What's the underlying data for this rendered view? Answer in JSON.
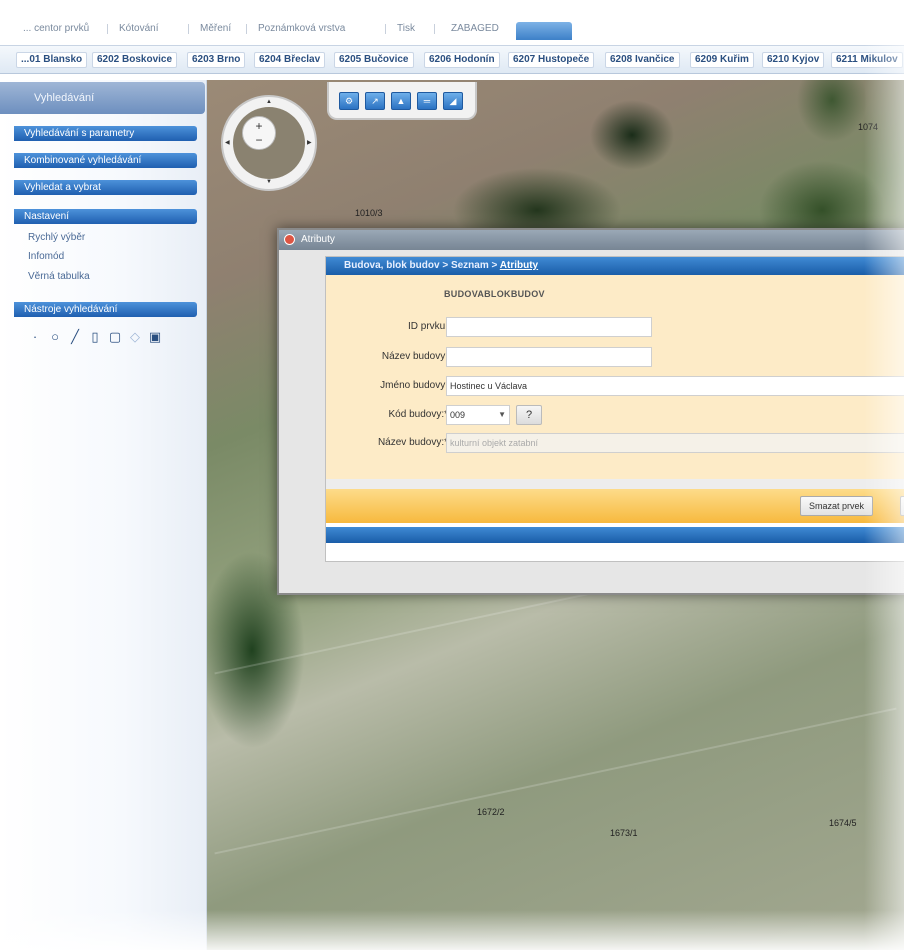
{
  "tabs": [
    {
      "label": "... centor prvků"
    },
    {
      "label": "Kótování"
    },
    {
      "label": "Měření"
    },
    {
      "label": "Poznámková vrstva"
    },
    {
      "label": "Tisk"
    },
    {
      "label": "ZABAGED"
    },
    {
      "label": "",
      "active": true
    }
  ],
  "districts": [
    {
      "label": "...01 Blansko"
    },
    {
      "label": "6202 Boskovice"
    },
    {
      "label": "6203 Brno"
    },
    {
      "label": "6204 Břeclav"
    },
    {
      "label": "6205 Bučovice"
    },
    {
      "label": "6206 Hodonín"
    },
    {
      "label": "6207 Hustopeče"
    },
    {
      "label": "6208 Ivančice"
    },
    {
      "label": "6209 Kuřim"
    },
    {
      "label": "6210 Kyjov"
    },
    {
      "label": "6211 Mikulov"
    }
  ],
  "sidebar": {
    "header": "Vyhledávání",
    "bars": [
      "Vyhledávání s parametry",
      "Kombinované vyhledávání",
      "Vyhledat a vybrat",
      "Nastavení"
    ],
    "settings_items": [
      "Rychlý výběr",
      "Infomód",
      "Věrná tabulka"
    ],
    "tools_bar": "Nástroje vyhledávání",
    "tool_icons": [
      "point-icon",
      "circle-icon",
      "line-icon",
      "rectangle-icon",
      "polygon-icon",
      "freehand-icon",
      "image-icon"
    ]
  },
  "map": {
    "labels": [
      "1010/3",
      "1074",
      "1672/2",
      "1673/1",
      "1674/5"
    ]
  },
  "dialog": {
    "title": "Atributy",
    "breadcrumb": "Budova, blok budov > Seznam > ",
    "breadcrumb_link": "Atributy",
    "form_title": "BUDOVABLOKBUDOV",
    "fields": {
      "id_label": "ID prvku:",
      "id_value": "",
      "name1_label": "Název budovy:",
      "name1_value": "",
      "jmeno_label": "Jméno budovy:",
      "jmeno_value": "Hostinec u Václava",
      "kod_label": "Kód budovy:*",
      "kod_value": "009",
      "name2_label": "Název budovy:*",
      "name2_value": "kulturní objekt zatabní"
    },
    "help_label": "?",
    "delete_label": "Smazat prvek"
  },
  "colors": {
    "accent_blue": "#1f5fb0",
    "form_bg": "#fdebc7",
    "action_bar": "#f7b93e"
  }
}
